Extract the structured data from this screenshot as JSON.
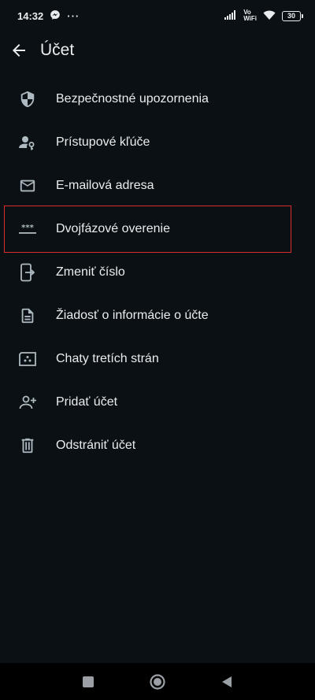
{
  "status_bar": {
    "time": "14:32",
    "more": "···",
    "vowifi_top": "Vo",
    "vowifi_bottom": "WiFi",
    "battery": "30",
    "icons": [
      "messenger-icon",
      "signal-icon",
      "wifi-icon",
      "battery-icon"
    ]
  },
  "header": {
    "title": "Účet",
    "back_icon": "arrow-left-icon"
  },
  "items": [
    {
      "label": "Bezpečnostné upozornenia",
      "icon": "shield-icon"
    },
    {
      "label": "Prístupové kľúče",
      "icon": "person-key-icon"
    },
    {
      "label": "E-mailová adresa",
      "icon": "mail-icon"
    },
    {
      "label": "Dvojfázové overenie",
      "icon": "password-dots-icon",
      "highlighted": true
    },
    {
      "label": "Zmeniť číslo",
      "icon": "phone-transfer-icon"
    },
    {
      "label": "Žiadosť o informácie o účte",
      "icon": "document-icon"
    },
    {
      "label": "Chaty tretích strán",
      "icon": "third-party-chat-icon"
    },
    {
      "label": "Pridať účet",
      "icon": "person-add-icon"
    },
    {
      "label": "Odstrániť účet",
      "icon": "trash-icon"
    }
  ],
  "colors": {
    "background": "#0b1014",
    "text": "#e9edef",
    "icon": "#aebac1",
    "highlight_border": "#d92c2c",
    "nav_bar": "#000000"
  }
}
